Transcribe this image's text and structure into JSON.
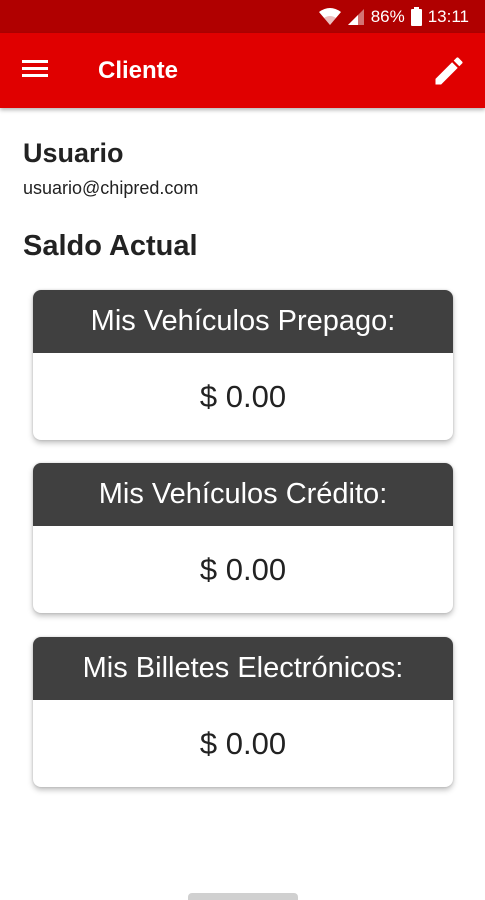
{
  "status_bar": {
    "battery_percent": "86%",
    "time": "13:11",
    "icons": [
      "wifi-icon",
      "signal-icon",
      "battery-icon"
    ]
  },
  "app_bar": {
    "title": "Cliente",
    "menu_icon": "hamburger-menu-icon",
    "edit_icon": "pencil-edit-icon"
  },
  "user": {
    "name": "Usuario",
    "email": "usuario@chipred.com"
  },
  "balance": {
    "title": "Saldo Actual",
    "cards": [
      {
        "label": "Mis Vehículos Prepago:",
        "value": "$ 0.00"
      },
      {
        "label": "Mis Vehículos Crédito:",
        "value": "$ 0.00"
      },
      {
        "label": "Mis Billetes Electrónicos:",
        "value": "$ 0.00"
      }
    ]
  },
  "colors": {
    "status_bar": "#b00000",
    "app_bar": "#e00000",
    "card_header": "#404040"
  }
}
